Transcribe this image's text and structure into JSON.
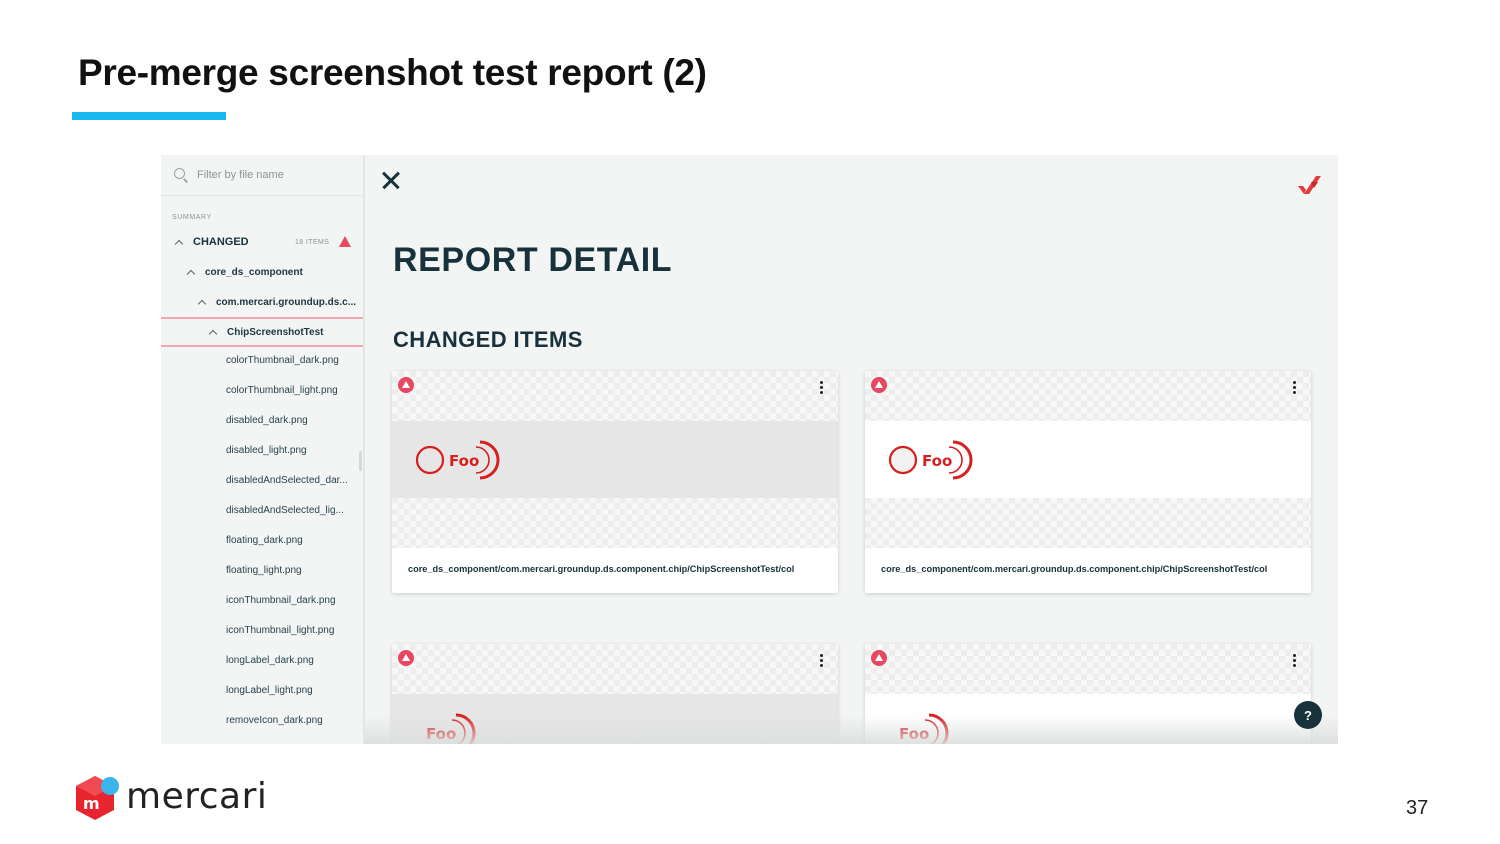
{
  "slide": {
    "title": "Pre-merge screenshot test report (2)",
    "page_number": "37",
    "brand": "mercari",
    "accent_color": "#1ab8f0"
  },
  "sidebar": {
    "filter_placeholder": "Filter by file name",
    "summary_label": "SUMMARY",
    "changed_label": "CHANGED",
    "changed_count": "18 ITEMS",
    "tree": {
      "module": "core_ds_component",
      "package": "com.mercari.groundup.ds.c...",
      "test_class": "ChipScreenshotTest"
    },
    "files": [
      "colorThumbnail_dark.png",
      "colorThumbnail_light.png",
      "disabled_dark.png",
      "disabled_light.png",
      "disabledAndSelected_dar...",
      "disabledAndSelected_lig...",
      "floating_dark.png",
      "floating_light.png",
      "iconThumbnail_dark.png",
      "iconThumbnail_light.png",
      "longLabel_dark.png",
      "longLabel_light.png",
      "removeIcon_dark.png"
    ]
  },
  "report": {
    "title": "REPORT DETAIL",
    "section_title": "CHANGED ITEMS",
    "cards": [
      {
        "path": "core_ds_component/com.mercari.groundup.ds.component.chip/ChipScreenshotTest/col",
        "theme": "dark"
      },
      {
        "path": "core_ds_component/com.mercari.groundup.ds.component.chip/ChipScreenshotTest/col",
        "theme": "light"
      },
      {
        "path": "",
        "theme": "dark"
      },
      {
        "path": "",
        "theme": "light"
      }
    ],
    "help_label": "?",
    "warning_color": "#e64860"
  }
}
